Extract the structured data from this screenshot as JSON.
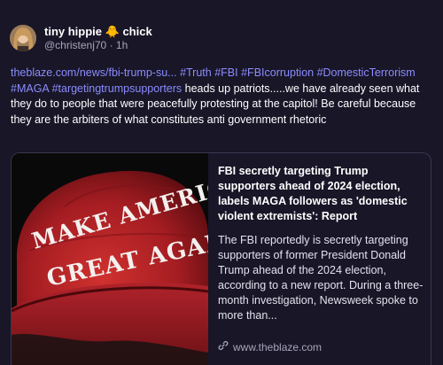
{
  "author": {
    "display_name": "tiny hippie",
    "name_suffix": "chick",
    "name_emoji": "🐥",
    "handle": "@christenj70",
    "separator": "·",
    "time": "1h"
  },
  "post": {
    "link_text": "theblaze.com/news/fbi-trump-su...",
    "hashtags": [
      "#Truth",
      "#FBI",
      "#FBIcorruption",
      "#DomesticTerrorism",
      "#MAGA",
      "#targetingtrumpsupporters"
    ],
    "body": "heads up patriots.....we have already seen what they do to people that were peacefully protesting at the capitol!  Be careful because they are the arbiters of what constitutes anti government rhetoric"
  },
  "card": {
    "image_text_line1": "MAKE AMERICA",
    "image_text_line2": "GREAT AGAIN",
    "title": "FBI secretly targeting Trump supporters ahead of 2024 election, labels MAGA followers as 'domestic violent extremists': Report",
    "description": "The FBI reportedly is secretly targeting supporters of former President Donald Trump ahead of the 2024 election, according to a new report. During a three-month investigation, Newsweek spoke to more than...",
    "domain": "www.theblaze.com",
    "domain_icon": "link-icon"
  },
  "colors": {
    "background": "#181627",
    "link": "#8c8cff",
    "muted": "#a8a5b8",
    "hat_red": "#c4262b"
  }
}
